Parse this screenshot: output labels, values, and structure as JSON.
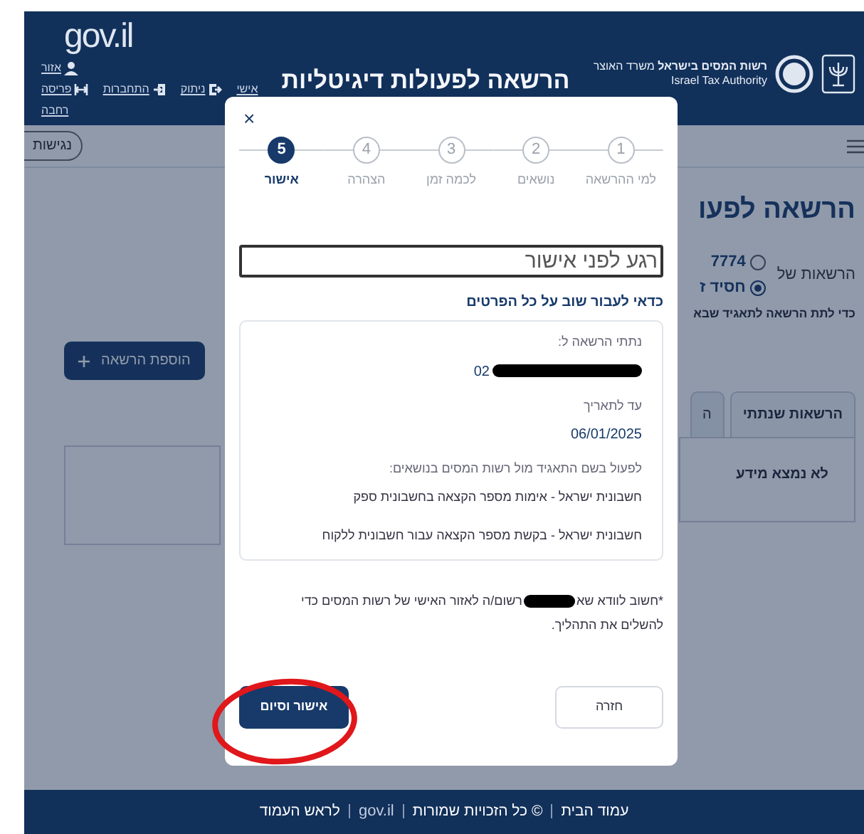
{
  "header": {
    "logo": "gov.il",
    "user_links": [
      [
        {
          "label": "אזור"
        }
      ],
      [
        {
          "label": "אישי"
        },
        {
          "label": "ניתוק"
        },
        {
          "label": "התחברות"
        },
        {
          "label": "פריסה"
        }
      ],
      [
        {
          "label": "רחבה"
        }
      ]
    ],
    "title": "הרשאה לפעולות דיגיטליות",
    "agency": {
      "name": "רשות המסים בישראל",
      "ministry": "משרד האוצר",
      "name_en": "Israel Tax Authority"
    }
  },
  "toolbar": {
    "accessibility": "נגישות"
  },
  "page": {
    "title": "הרשאה לפעו",
    "permissions_label": "הרשאות של",
    "options": [
      {
        "label": "7774",
        "selected": false
      },
      {
        "label": "חסיד ז",
        "selected": true
      }
    ],
    "hint": "כדי לתת הרשאה לתאגיד שבא",
    "add_button": "הוספת הרשאה",
    "tabs": [
      {
        "label": "הרשאות שנתתי",
        "selected": true
      },
      {
        "label": "ה",
        "selected": false
      }
    ],
    "empty_message": "לא נמצא מידע"
  },
  "modal": {
    "close": "×",
    "steps": [
      {
        "number": "1",
        "label": "למי ההרשאה",
        "selected": false
      },
      {
        "number": "2",
        "label": "נושאים",
        "selected": false
      },
      {
        "number": "3",
        "label": "לכמה זמן",
        "selected": false
      },
      {
        "number": "4",
        "label": "הצהרה",
        "selected": false
      },
      {
        "number": "5",
        "label": "אישור",
        "selected": true
      }
    ],
    "heading": "רגע לפני אישור",
    "subheading": "כדאי לעבור שוב על כל הפרטים",
    "summary": {
      "recipient_label": "נתתי הרשאה ל:",
      "recipient_value": "02",
      "date_label": "עד לתאריך",
      "date_value": "06/01/2025",
      "topics_label": "לפעול בשם התאגיד מול רשות המסים בנושאים:",
      "topics": [
        "חשבונית ישראל - אימות מספר הקצאה בחשבונית ספק",
        "חשבונית ישראל - בקשת מספר הקצאה עבור חשבונית ללקוח"
      ]
    },
    "note_start": "*חשוב לוודא שא",
    "note_middle": "רשום/ה לאזור האישי של רשות המסים כדי",
    "note_end": "להשלים את התהליך.",
    "buttons": [
      {
        "label": "חזרה",
        "kind": "secondary"
      },
      {
        "label": "אישור וסיום",
        "kind": "primary"
      }
    ]
  },
  "footer": {
    "links": [
      {
        "label": "עמוד הבית",
        "kind": "link"
      },
      {
        "label": "© כל הזכויות שמורות",
        "kind": "link"
      },
      {
        "label": "gov.il",
        "kind": "logo"
      },
      {
        "label": "לראש העמוד",
        "kind": "link"
      }
    ]
  }
}
